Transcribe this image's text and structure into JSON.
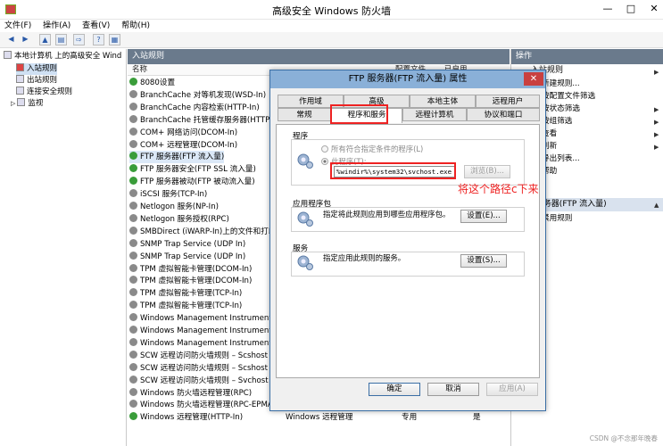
{
  "window": {
    "title": "高级安全 Windows 防火墙"
  },
  "menu": [
    "文件(F)",
    "操作(A)",
    "查看(V)",
    "帮助(H)"
  ],
  "tree": {
    "root": "本地计算机 上的高级安全 Wind",
    "items": [
      "入站规则",
      "出站规则",
      "连接安全规则",
      "监视"
    ]
  },
  "list": {
    "header": "入站规则",
    "columns": [
      "名称",
      "配置文件",
      "已启用"
    ],
    "rows": [
      {
        "name": "8080设置",
        "enabled": true
      },
      {
        "name": "BranchCache 对等机发现(WSD-In)",
        "enabled": false
      },
      {
        "name": "BranchCache 内容检索(HTTP-In)",
        "enabled": false
      },
      {
        "name": "BranchCache 托管缓存服务器(HTTP-In)",
        "enabled": false
      },
      {
        "name": "COM+ 网络访问(DCOM-In)",
        "enabled": false
      },
      {
        "name": "COM+ 远程管理(DCOM-In)",
        "enabled": false
      },
      {
        "name": "FTP 服务器(FTP 流入量)",
        "enabled": true
      },
      {
        "name": "FTP 服务器安全(FTP SSL 流入量)",
        "enabled": true
      },
      {
        "name": "FTP 服务器被动(FTP 被动流入量)",
        "enabled": true
      },
      {
        "name": "iSCSI 服务(TCP-In)",
        "enabled": false
      },
      {
        "name": "Netlogon 服务(NP-In)",
        "enabled": false
      },
      {
        "name": "Netlogon 服务授权(RPC)",
        "enabled": false
      },
      {
        "name": "SMBDirect (iWARP-In)上的文件和打印",
        "enabled": false
      },
      {
        "name": "SNMP Trap Service (UDP In)",
        "enabled": false
      },
      {
        "name": "SNMP Trap Service (UDP In)",
        "enabled": false
      },
      {
        "name": "TPM 虚拟智能卡管理(DCOM-In)",
        "enabled": false
      },
      {
        "name": "TPM 虚拟智能卡管理(DCOM-In)",
        "enabled": false
      },
      {
        "name": "TPM 虚拟智能卡管理(TCP-In)",
        "enabled": false
      },
      {
        "name": "TPM 虚拟智能卡管理(TCP-In)",
        "enabled": false
      },
      {
        "name": "Windows Management Instrumenta",
        "enabled": false
      },
      {
        "name": "Windows Management Instrumenta",
        "enabled": false
      },
      {
        "name": "Windows Management Instrumenta",
        "enabled": false
      },
      {
        "name": "SCW 远程访问防火墙规则 – Scshost",
        "enabled": false
      },
      {
        "name": "SCW 远程访问防火墙规则 – Scshost",
        "enabled": false
      },
      {
        "name": "SCW 远程访问防火墙规则 – Svchost",
        "enabled": false
      },
      {
        "name": "Windows 防火墙远程管理(RPC)",
        "enabled": false
      },
      {
        "name": "Windows 防火墙远程管理(RPC-EPMA",
        "enabled": false
      },
      {
        "name": "Windows 远程管理(HTTP-In)",
        "enabled": true
      }
    ],
    "last_row_extra": {
      "group": "Windows 远程管理",
      "profile": "专用",
      "enabled": "是"
    }
  },
  "actions": {
    "header": "操作",
    "items": [
      "入站规则",
      "新建规则...",
      "按配置文件筛选",
      "按状态筛选",
      "按组筛选",
      "查看",
      "刷新",
      "导出列表...",
      "帮助"
    ],
    "section": "FTP 服务器(FTP 流入量)",
    "section_items": [
      "禁用规则"
    ]
  },
  "dialog": {
    "title": "FTP 服务器(FTP 流入量) 属性",
    "tabs_top": [
      "作用域",
      "高级",
      "本地主体",
      "远程用户"
    ],
    "tabs_bottom": [
      "常规",
      "程序和服务",
      "远程计算机",
      "协议和端口"
    ],
    "program_label": "程序",
    "radio_all": "所有符合指定条件的程序(L)",
    "radio_this": "此程序(T):",
    "program_path": "%windir%\\system32\\svchost.exe",
    "browse": "浏览(B)...",
    "packages_label": "应用程序包",
    "packages_desc": "指定将此规则应用到哪些应用程序包。",
    "packages_btn": "设置(E)...",
    "services_label": "服务",
    "services_desc": "指定应用此规则的服务。",
    "services_btn": "设置(S)...",
    "ok": "确定",
    "cancel": "取消",
    "apply": "应用(A)"
  },
  "annotation": "将这个路径c下来",
  "watermark": "CSDN @不念那年晚春",
  "colors": {
    "accent_red": "#e22222",
    "enabled_green": "#3a9d3a",
    "pane_header": "#6a7a8c"
  }
}
